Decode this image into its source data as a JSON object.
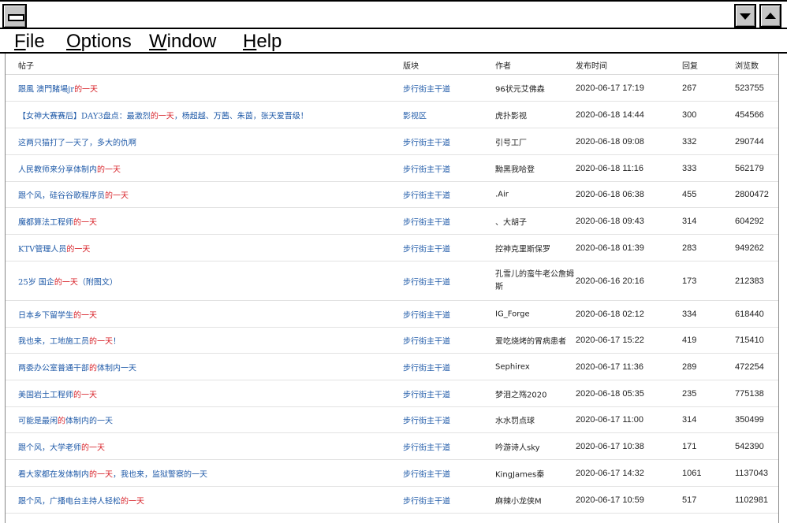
{
  "window": {
    "title": "",
    "menu": [
      "File",
      "Options",
      "Window",
      "Help"
    ],
    "menu_mnemonics": [
      "F",
      "O",
      "W",
      "H"
    ]
  },
  "table": {
    "headers": {
      "title": "帖子",
      "board": "版块",
      "author": "作者",
      "time": "发布时间",
      "replies": "回复",
      "views": "浏览数"
    },
    "rows": [
      {
        "title_pre": "跟風 澳門賭場jr",
        "title_hl": "的一天",
        "title_post": "",
        "board": "步行街主干道",
        "author": "96状元艾佛森",
        "time": "2020-06-17 17:19",
        "replies": "267",
        "views": "523755"
      },
      {
        "title_pre": "【女神大赛赛后】DAY3盘点：最激烈",
        "title_hl": "的一天",
        "title_post": "，杨超越、万茜、朱茵，张天爱晋级！",
        "board": "影视区",
        "author": "虎扑影视",
        "time": "2020-06-18 14:44",
        "replies": "300",
        "views": "454566"
      },
      {
        "title_pre": "这两只猫打了一天了，多大的仇啊",
        "title_hl": "",
        "title_post": "",
        "board": "步行街主干道",
        "author": "引号工厂",
        "time": "2020-06-18 09:08",
        "replies": "332",
        "views": "290744"
      },
      {
        "title_pre": "人民教师来分享体制内",
        "title_hl": "的一天",
        "title_post": "",
        "board": "步行街主干道",
        "author": "黝黑我哈登",
        "time": "2020-06-18 11:16",
        "replies": "333",
        "views": "562179"
      },
      {
        "title_pre": "跟个风，硅谷谷歌程序员",
        "title_hl": "的一天",
        "title_post": "",
        "board": "步行街主干道",
        "author": ".Air",
        "time": "2020-06-18 06:38",
        "replies": "455",
        "views": "2800472"
      },
      {
        "title_pre": "魔都算法工程师",
        "title_hl": "的一天",
        "title_post": "",
        "board": "步行街主干道",
        "author": "、大胡子",
        "time": "2020-06-18 09:43",
        "replies": "314",
        "views": "604292"
      },
      {
        "title_pre": "KTV管理人员",
        "title_hl": "的一天",
        "title_post": "",
        "board": "步行街主干道",
        "author": "控神克里斯保罗",
        "time": "2020-06-18 01:39",
        "replies": "283",
        "views": "949262"
      },
      {
        "title_pre": "25岁 国企",
        "title_hl": "的一天",
        "title_post": "（附图文）",
        "board": "步行街主干道",
        "author": "孔雪儿的蛮牛老公詹姆斯",
        "time": "2020-06-16 20:16",
        "replies": "173",
        "views": "212383"
      },
      {
        "title_pre": "日本乡下留学生",
        "title_hl": "的一天",
        "title_post": "",
        "board": "步行街主干道",
        "author": "IG_Forge",
        "time": "2020-06-18 02:12",
        "replies": "334",
        "views": "618440"
      },
      {
        "title_pre": "我也来，工地施工员",
        "title_hl": "的一天",
        "title_post": "！",
        "board": "步行街主干道",
        "author": "爱吃烧烤的胃病患者",
        "time": "2020-06-17 15:22",
        "replies": "419",
        "views": "715410"
      },
      {
        "title_pre": "两委办公室普通干部",
        "title_hl": "的",
        "title_post": "体制内一天",
        "board": "步行街主干道",
        "author": "Sephirex",
        "time": "2020-06-17 11:36",
        "replies": "289",
        "views": "472254"
      },
      {
        "title_pre": "美国岩土工程师",
        "title_hl": "的一天",
        "title_post": "",
        "board": "步行街主干道",
        "author": "梦泪之殇2020",
        "time": "2020-06-18 05:35",
        "replies": "235",
        "views": "775138"
      },
      {
        "title_pre": "可能是最闲",
        "title_hl": "的",
        "title_post": "体制内的一天",
        "board": "步行街主干道",
        "author": "水水罚点球",
        "time": "2020-06-17 11:00",
        "replies": "314",
        "views": "350499"
      },
      {
        "title_pre": "跟个风，大学老师",
        "title_hl": "的一天",
        "title_post": "",
        "board": "步行街主干道",
        "author": "吟游诗人sky",
        "time": "2020-06-17 10:38",
        "replies": "171",
        "views": "542390"
      },
      {
        "title_pre": "看大家都在发体制内",
        "title_hl": "的一天",
        "title_post": "，我也来，监狱警察的一天",
        "board": "步行街主干道",
        "author": "KingJames秦",
        "time": "2020-06-17 14:32",
        "replies": "1061",
        "views": "1137043"
      },
      {
        "title_pre": "跟个风，广播电台主持人轻松",
        "title_hl": "的一天",
        "title_post": "",
        "board": "步行街主干道",
        "author": "麻辣小龙侠M",
        "time": "2020-06-17 10:59",
        "replies": "517",
        "views": "1102981"
      }
    ]
  }
}
